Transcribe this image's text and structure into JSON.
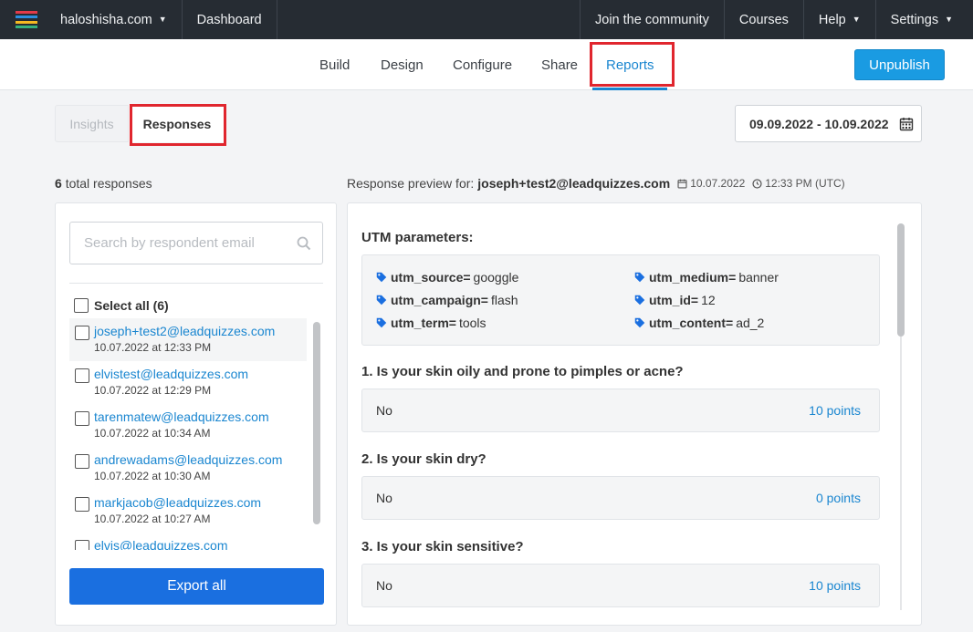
{
  "topbar": {
    "site": "haloshisha.com",
    "dashboard": "Dashboard",
    "community": "Join the community",
    "courses": "Courses",
    "help": "Help",
    "settings": "Settings",
    "logo_colors": [
      "#e23b4a",
      "#2b8fe0",
      "#f5b921",
      "#36b37e"
    ]
  },
  "nav": {
    "tabs": [
      "Build",
      "Design",
      "Configure",
      "Share",
      "Reports"
    ],
    "active_tab": "Reports",
    "unpublish": "Unpublish"
  },
  "subtabs": {
    "insights": "Insights",
    "responses": "Responses"
  },
  "date_range": "09.09.2022 - 10.09.2022",
  "summary": {
    "count": "6",
    "label": "total responses"
  },
  "preview": {
    "label": "Response preview for:",
    "email": "joseph+test2@leadquizzes.com",
    "date": "10.07.2022",
    "time": "12:33 PM (UTC)"
  },
  "left": {
    "search_placeholder": "Search by respondent email",
    "select_all": "Select all (6)",
    "items": [
      {
        "email": "joseph+test2@leadquizzes.com",
        "when": "10.07.2022 at 12:33 PM"
      },
      {
        "email": "elvistest@leadquizzes.com",
        "when": "10.07.2022 at 12:29 PM"
      },
      {
        "email": "tarenmatew@leadquizzes.com",
        "when": "10.07.2022 at 10:34 AM"
      },
      {
        "email": "andrewadams@leadquizzes.com",
        "when": "10.07.2022 at 10:30 AM"
      },
      {
        "email": "markjacob@leadquizzes.com",
        "when": "10.07.2022 at 10:27 AM"
      },
      {
        "email": "elvis@leadquizzes.com",
        "when": ""
      }
    ],
    "export": "Export all"
  },
  "utm": {
    "title": "UTM parameters:",
    "params": [
      {
        "key": "utm_source=",
        "value": "googgle"
      },
      {
        "key": "utm_medium=",
        "value": "banner"
      },
      {
        "key": "utm_campaign=",
        "value": "flash"
      },
      {
        "key": "utm_id=",
        "value": "12"
      },
      {
        "key": "utm_term=",
        "value": "tools"
      },
      {
        "key": "utm_content=",
        "value": "ad_2"
      }
    ]
  },
  "questions": [
    {
      "title": "1. Is your skin oily and prone to pimples or acne?",
      "answer": "No",
      "points": "10 points"
    },
    {
      "title": "2. Is your skin dry?",
      "answer": "No",
      "points": "0 points"
    },
    {
      "title": "3. Is your skin sensitive?",
      "answer": "No",
      "points": "10 points"
    }
  ],
  "colors": {
    "accent": "#1a86d0",
    "topbar": "#262c33",
    "export_button": "#1a6fe0",
    "unpublish_button": "#1a9be2",
    "highlight": "#e0262e"
  }
}
